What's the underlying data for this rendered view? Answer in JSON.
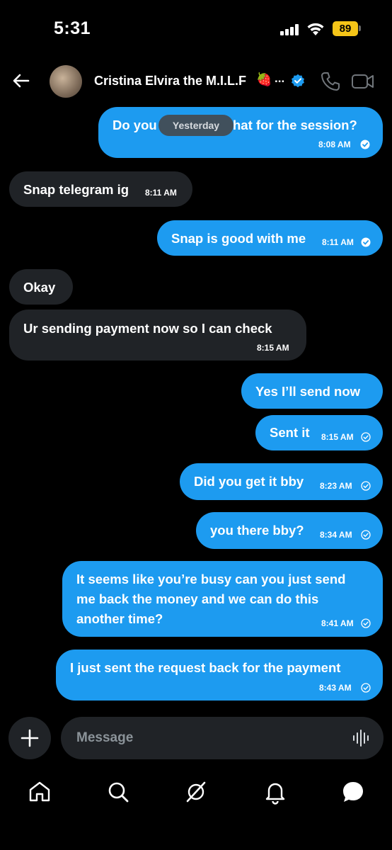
{
  "status_bar": {
    "time": "5:31",
    "battery": "89"
  },
  "header": {
    "contact_name": "Cristina Elvira the M.I.L.F",
    "emoji": "🍓",
    "ellipsis": "..."
  },
  "date_divider": "Yesterday",
  "messages": [
    {
      "side": "sent",
      "text": "Do you",
      "text_after": "hat for the session?",
      "time": "8:08 AM",
      "status": "read"
    },
    {
      "side": "received",
      "text": "Snap telegram ig",
      "time": "8:11 AM"
    },
    {
      "side": "sent",
      "text": "Snap is good with me",
      "time": "8:11 AM",
      "status": "read"
    },
    {
      "side": "received",
      "text": "Okay"
    },
    {
      "side": "received",
      "text": "Ur sending payment now so I can check",
      "time": "8:15 AM"
    },
    {
      "side": "sent",
      "text": "Yes I’ll send now"
    },
    {
      "side": "sent",
      "text": "Sent it",
      "time": "8:15 AM",
      "status": "sent"
    },
    {
      "side": "sent",
      "text": "Did you get it bby",
      "time": "8:23 AM",
      "status": "sent"
    },
    {
      "side": "sent",
      "text": "you there bby?",
      "time": "8:34 AM",
      "status": "sent"
    },
    {
      "side": "sent",
      "lines": [
        "It seems like you’re busy can you just send",
        "me back the money and we can do this",
        "another time?"
      ],
      "time": "8:41 AM",
      "status": "sent"
    },
    {
      "side": "sent",
      "text": "I just sent the request back for the payment",
      "time": "8:43 AM",
      "status": "sent"
    }
  ],
  "composer": {
    "placeholder": "Message"
  },
  "colors": {
    "sent_bubble": "#1d9bf0",
    "received_bubble": "#202327",
    "background": "#000000",
    "battery": "#f5c518"
  },
  "icons": {
    "header": [
      "back-arrow-icon",
      "verified-badge-icon",
      "phone-icon",
      "video-camera-icon"
    ],
    "composer": [
      "plus-icon",
      "voice-waveform-icon"
    ],
    "nav": [
      "home-icon",
      "search-icon",
      "grok-icon",
      "bell-icon",
      "messages-icon"
    ]
  }
}
